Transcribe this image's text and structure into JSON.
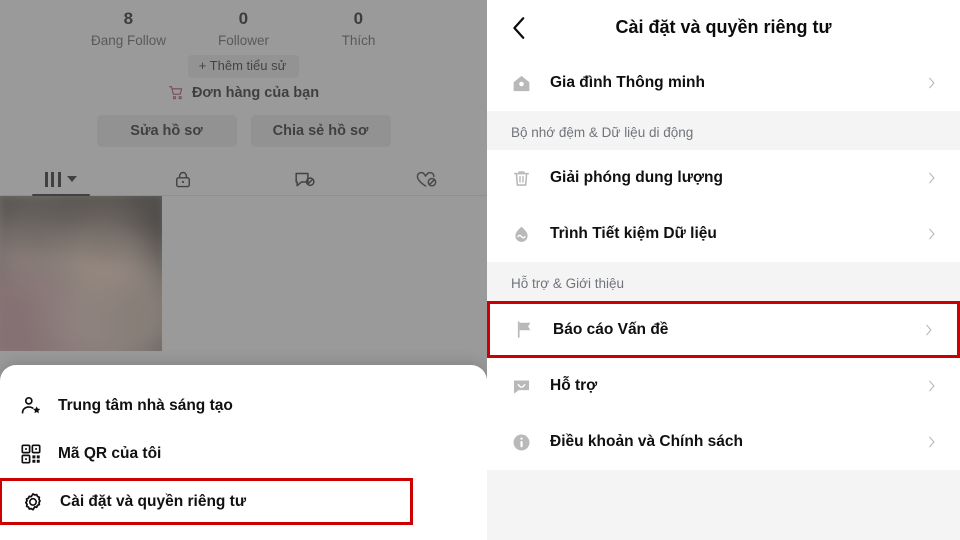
{
  "profile": {
    "stats": [
      {
        "value": "8",
        "label": "Đang Follow"
      },
      {
        "value": "0",
        "label": "Follower"
      },
      {
        "value": "0",
        "label": "Thích"
      }
    ],
    "add_bio_label": "+ Thêm tiểu sử",
    "orders_label": "Đơn hàng của bạn",
    "orders_icon": "shopping-cart-icon",
    "orders_icon_color": "#a7374d",
    "buttons": [
      {
        "label": "Sửa hồ sơ",
        "name": "edit-profile-button"
      },
      {
        "label": "Chia sẻ hồ sơ",
        "name": "share-profile-button"
      }
    ],
    "tabs": [
      {
        "name": "tab-posts-grid",
        "icon": "grid-bars-icon",
        "active": true
      },
      {
        "name": "tab-private",
        "icon": "lock-icon",
        "active": false
      },
      {
        "name": "tab-reposts",
        "icon": "repost-hidden-icon",
        "active": false
      },
      {
        "name": "tab-liked",
        "icon": "heart-hidden-icon",
        "active": false
      }
    ]
  },
  "bottom_sheet": {
    "items": [
      {
        "name": "sheet-item-creator-center",
        "icon": "person-star-icon",
        "label": "Trung tâm nhà sáng tạo",
        "highlighted": false
      },
      {
        "name": "sheet-item-my-qr",
        "icon": "qr-code-icon",
        "label": "Mã QR của tôi",
        "highlighted": false
      },
      {
        "name": "sheet-item-settings-privacy",
        "icon": "gear-icon",
        "label": "Cài đặt và quyền riêng tư",
        "highlighted": true
      }
    ]
  },
  "settings": {
    "title": "Cài đặt và quyền riêng tư",
    "back_icon": "chevron-left-icon",
    "highlight_color": "#cc0000",
    "groups": [
      {
        "name": "group-family",
        "header": "",
        "rows": [
          {
            "name": "row-family-pairing",
            "icon": "home-icon",
            "label": "Gia đình Thông minh",
            "chevron": "chevron-right-icon",
            "highlighted": false
          }
        ]
      },
      {
        "name": "group-cache-data",
        "header": "Bộ nhớ đệm & Dữ liệu di động",
        "rows": [
          {
            "name": "row-free-up-space",
            "icon": "trash-icon",
            "label": "Giải phóng dung lượng",
            "chevron": "chevron-right-icon",
            "highlighted": false
          },
          {
            "name": "row-data-saver",
            "icon": "data-saver-drop-icon",
            "label": "Trình Tiết kiệm Dữ liệu",
            "chevron": "chevron-right-icon",
            "highlighted": false
          }
        ]
      },
      {
        "name": "group-support-about",
        "header": "Hỗ trợ & Giới thiệu",
        "rows": [
          {
            "name": "row-report-problem",
            "icon": "flag-icon",
            "label": "Báo cáo Vấn đề",
            "chevron": "chevron-right-icon",
            "highlighted": true
          },
          {
            "name": "row-support",
            "icon": "chat-bubble-icon",
            "label": "Hỗ trợ",
            "chevron": "chevron-right-icon",
            "highlighted": false
          },
          {
            "name": "row-terms-policies",
            "icon": "info-circle-icon",
            "label": "Điều khoản và Chính sách",
            "chevron": "chevron-right-icon",
            "highlighted": false
          }
        ]
      }
    ]
  }
}
